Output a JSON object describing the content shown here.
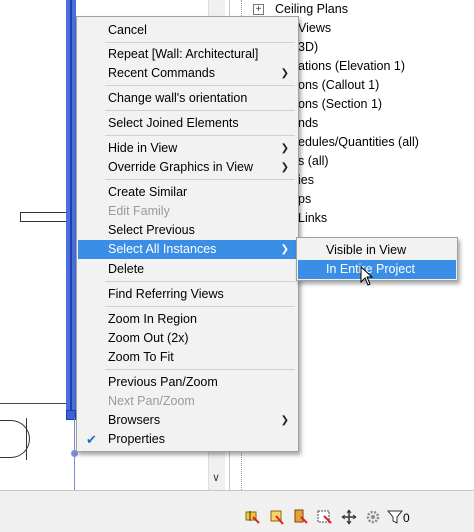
{
  "browser": {
    "items": [
      "Ceiling Plans",
      "Views",
      "3D)",
      "ations (Elevation 1)",
      "ons (Callout 1)",
      "ons (Section 1)",
      "nds",
      "edules/Quantities (all)",
      "s (all)",
      "ies",
      "ps",
      "Links"
    ]
  },
  "context_menu": {
    "items": [
      {
        "label": "Cancel"
      },
      {
        "label": "Repeat [Wall: Architectural]"
      },
      {
        "label": "Recent Commands",
        "submenu": true
      },
      {
        "label": "Change wall's orientation"
      },
      {
        "label": "Select Joined Elements"
      },
      {
        "label": "Hide in View",
        "submenu": true
      },
      {
        "label": "Override Graphics in View",
        "submenu": true
      },
      {
        "label": "Create Similar"
      },
      {
        "label": "Edit Family",
        "disabled": true
      },
      {
        "label": "Select Previous"
      },
      {
        "label": "Select All Instances",
        "submenu": true,
        "active": true
      },
      {
        "label": "Delete"
      },
      {
        "label": "Find Referring Views"
      },
      {
        "label": "Zoom In Region"
      },
      {
        "label": "Zoom Out (2x)"
      },
      {
        "label": "Zoom To Fit"
      },
      {
        "label": "Previous Pan/Zoom"
      },
      {
        "label": "Next Pan/Zoom",
        "disabled": true
      },
      {
        "label": "Browsers",
        "submenu": true
      },
      {
        "label": "Properties",
        "checked": true
      }
    ]
  },
  "submenu": {
    "items": [
      {
        "label": "Visible in View"
      },
      {
        "label": "In Entire Project",
        "active": true
      }
    ]
  },
  "icons": {
    "expand": "expand-plus-icon",
    "submenu_arrow": "chevron-right-icon",
    "check": "check-icon",
    "scroll_down": "chevron-down-icon",
    "statusbar": [
      "link-select-icon",
      "underlay-select-icon",
      "pinned-select-icon",
      "face-select-icon",
      "drag-select-icon",
      "gear-icon",
      "filter-icon"
    ],
    "filter_count": "0"
  },
  "colors": {
    "highlight": "#3a8ee6",
    "wall": "#4a6fd8",
    "disabled_text": "#9a9a9a"
  }
}
